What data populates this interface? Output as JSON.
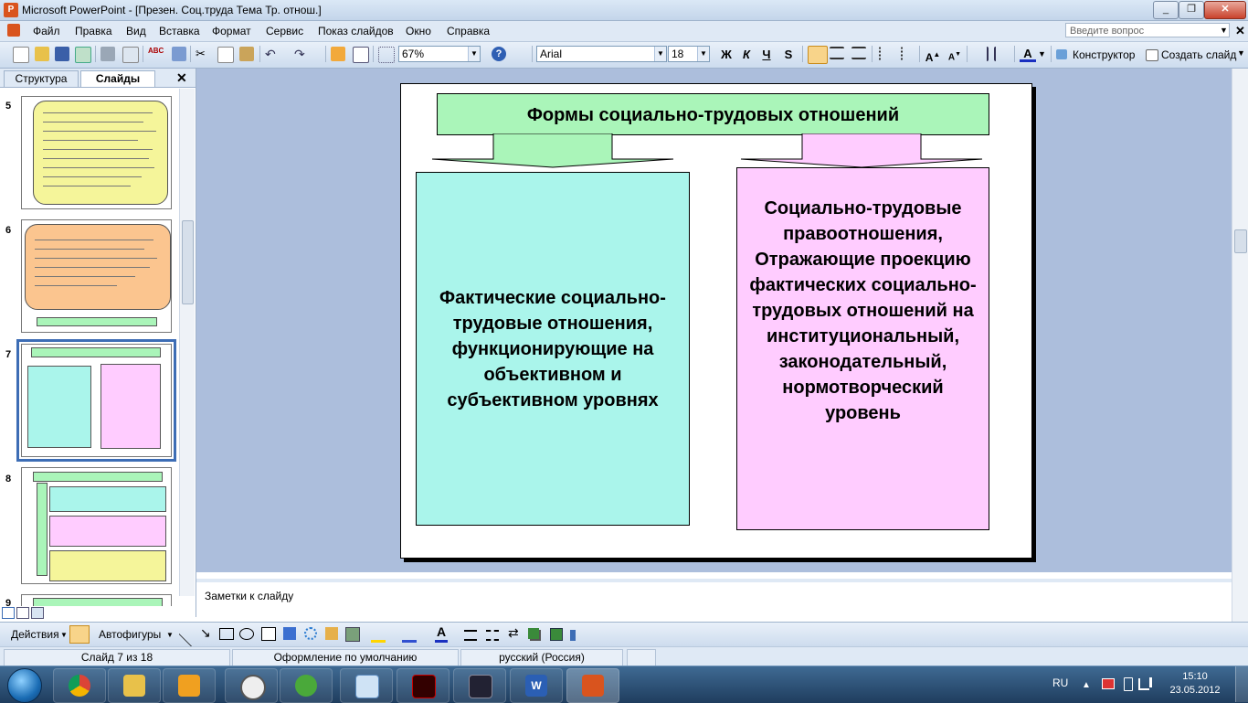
{
  "window": {
    "title": "Microsoft PowerPoint - [Презен. Соц.труда Тема Тр. отнош.]",
    "minimize": "_",
    "restore": "❐",
    "close": "✕"
  },
  "menu": [
    "Файл",
    "Правка",
    "Вид",
    "Вставка",
    "Формат",
    "Сервис",
    "Показ слайдов",
    "Окно",
    "Справка"
  ],
  "help_box": {
    "placeholder": "Введите вопрос"
  },
  "toolbar": {
    "zoom": "67%",
    "font": "Arial",
    "font_size": "18",
    "bold": "Ж",
    "italic": "К",
    "underline": "Ч",
    "shadow": "S",
    "designer": "Конструктор",
    "new_slide": "Создать слайд"
  },
  "left_panel": {
    "tab_outline": "Структура",
    "tab_slides": "Слайды",
    "close": "✕",
    "slide_numbers": [
      "5",
      "6",
      "7",
      "8",
      "9"
    ]
  },
  "slide": {
    "title": "Формы социально-трудовых отношений",
    "left_box": "Фактические социально-трудовые отношения, функционирующие на объективном и субъективном уровнях",
    "right_box": "Социально-трудовые правоотношения, Отражающие проекцию фактических социально-трудовых отношений на институциональный, законодательный, нормотворческий уровень"
  },
  "notes": {
    "label": "Заметки к слайду"
  },
  "drawing_toolbar": {
    "actions": "Действия",
    "autoshapes": "Автофигуры"
  },
  "status_bar": {
    "slide_info": "Слайд 7 из 18",
    "design": "Оформление по умолчанию",
    "language": "русский (Россия)"
  },
  "taskbar": {
    "language": "RU",
    "time": "15:10",
    "date": "23.05.2012"
  },
  "colors": {
    "title_box": "#aaf5b9",
    "left_box": "#aaf5eb",
    "right_box": "#ffccff",
    "work_area": "#acbedc"
  }
}
